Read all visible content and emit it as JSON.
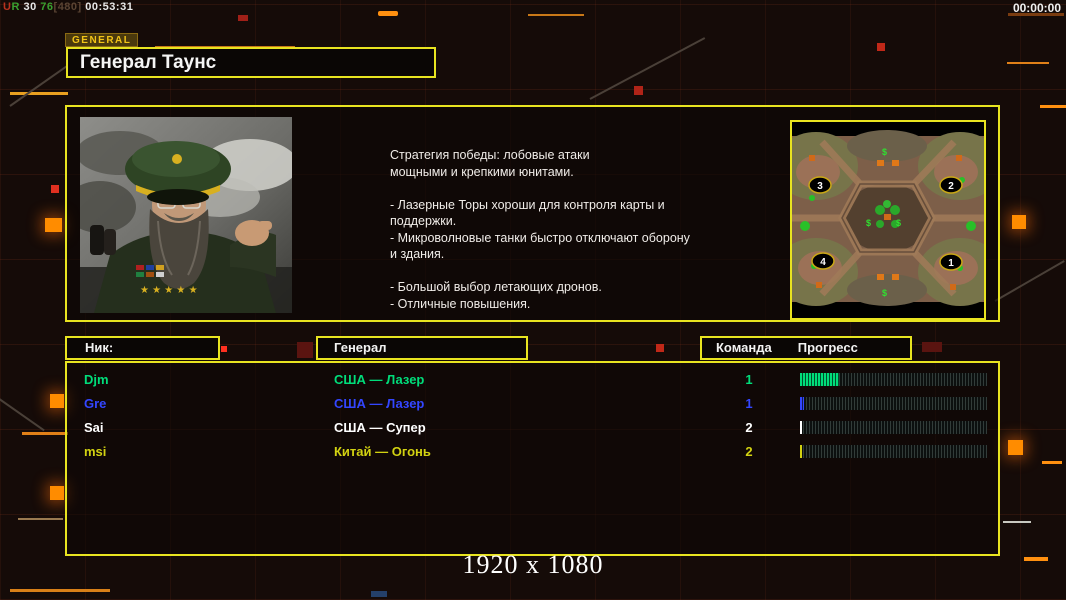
{
  "hud": {
    "debug": {
      "u": "U",
      "r": "R",
      "fps": "30",
      "num": "76",
      "bracket": "[480]",
      "clock": "00:53:31"
    },
    "timer": "00:00:00"
  },
  "header": {
    "tab": "GENERAL",
    "title": "Генерал Таунс"
  },
  "info": {
    "strategy": "Стратегия победы: лобовые атаки\nмощными и крепкими юнитами.\n\n- Лазерные Торы хороши для контроля карты и\nподдержки.\n- Микроволновые танки быстро отключают оборону\nи здания.\n\n- Большой выбор летающих дронов.\n- Отличные повышения."
  },
  "map": {
    "positions": [
      "1",
      "2",
      "3",
      "4"
    ],
    "supply": "$"
  },
  "table": {
    "headers": {
      "nick": "Ник:",
      "general": "Генерал",
      "team": "Команда",
      "progress": "Прогресс"
    },
    "rows": [
      {
        "nick": "Djm",
        "general": "США — Лазер",
        "team": "1",
        "color": "#00dd7a",
        "progress_pct": 21
      },
      {
        "nick": "Gre",
        "general": "США — Лазер",
        "team": "1",
        "color": "#3346ff",
        "progress_pct": 2
      },
      {
        "nick": "Sai",
        "general": "США — Супер",
        "team": "2",
        "color": "#ffffff",
        "progress_pct": 1
      },
      {
        "nick": "msi",
        "general": "Китай — Огонь",
        "team": "2",
        "color": "#d2d211",
        "progress_pct": 1
      }
    ]
  },
  "footer": {
    "resolution": "1920 x 1080"
  },
  "colors": {
    "panel_border": "#e8e420",
    "circuit_orange": "#ff8c00",
    "background": "#150b08",
    "supply_green": "#30e030"
  }
}
